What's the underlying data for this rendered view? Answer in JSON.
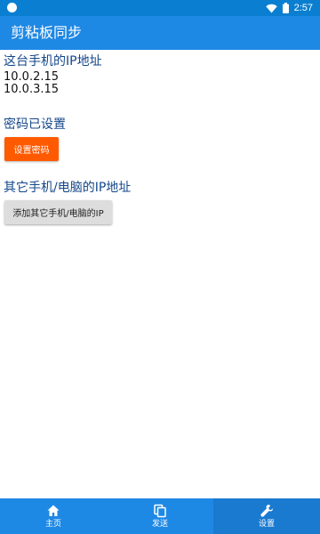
{
  "status_bar": {
    "time": "2:57",
    "icons": [
      "notification-dot-icon",
      "wifi-icon",
      "battery-icon"
    ]
  },
  "app_bar": {
    "title": "剪粘板同步"
  },
  "sections": {
    "this_device": {
      "title": "这台手机的IP地址",
      "ips": [
        "10.0.2.15",
        "10.0.3.15"
      ]
    },
    "password": {
      "status": "密码已设置",
      "button_label": "设置密码"
    },
    "other_devices": {
      "title": "其它手机/电脑的IP地址",
      "button_label": "添加其它手机/电脑的IP"
    }
  },
  "bottom_nav": {
    "items": [
      {
        "label": "主页",
        "icon": "home-icon"
      },
      {
        "label": "发送",
        "icon": "copy-icon"
      },
      {
        "label": "设置",
        "icon": "wrench-icon",
        "active": true
      }
    ]
  },
  "colors": {
    "primary": "#1e88e5",
    "status_bar": "#0a7fd1",
    "accent_button": "#ff5a00",
    "section_title": "#14478a",
    "neutral_button": "#dddddd"
  }
}
